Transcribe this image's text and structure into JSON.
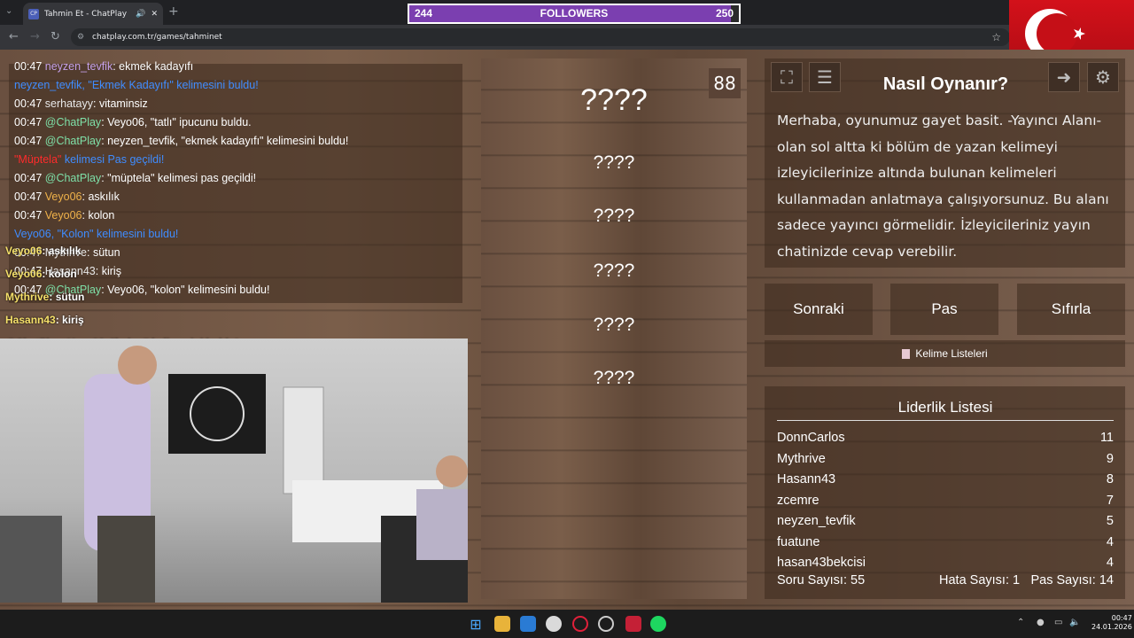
{
  "browser": {
    "tab_title": "Tahmin Et - ChatPlay",
    "tab_favicon": "CP",
    "url": "chatplay.com.tr/games/tahminet"
  },
  "followers": {
    "current": "244",
    "label": "FOLLOWERS",
    "goal": "250",
    "progress": 0.976,
    "color": "#7b3fb0"
  },
  "chat": {
    "lines": [
      {
        "time": "00:47",
        "user": "neyzen_tevfik",
        "sep": ":",
        "text": "ekmek kadayıfı"
      },
      {
        "time": "",
        "user": "neyzen_tevfik, \"Ekmek Kadayıfı\"",
        "sep": "",
        "text": "kelimesini buldu!"
      },
      {
        "time": "00:47",
        "user": "serhatayy",
        "sep": ":",
        "text": "vitaminsiz"
      },
      {
        "time": "00:47",
        "user": "@ChatPlay",
        "sep": ":",
        "text": "Veyo06, \"tatlı\" ipucunu buldu."
      },
      {
        "time": "00:47",
        "user": "@ChatPlay",
        "sep": ":",
        "text": "neyzen_tevfik, \"ekmek kadayıfı\" kelimesini buldu!"
      },
      {
        "time": "",
        "user": "\"Müptela\"",
        "sep": "",
        "text": "kelimesi Pas geçildi!"
      },
      {
        "time": "00:47",
        "user": "@ChatPlay",
        "sep": ":",
        "text": "\"müptela\" kelimesi pas geçildi!"
      },
      {
        "time": "00:47",
        "user": "Veyo06",
        "sep": ":",
        "text": "askılık"
      },
      {
        "time": "00:47",
        "user": "Veyo06",
        "sep": ":",
        "text": "kolon"
      },
      {
        "time": "",
        "user": "Veyo06, \"Kolon\"",
        "sep": "",
        "text": "kelimesini buldu!"
      },
      {
        "time": "00:47",
        "user": "Mythrive",
        "sep": ":",
        "text": "sütun"
      },
      {
        "time": "00:47",
        "user": "Hasann43",
        "sep": ":",
        "text": "kiriş"
      },
      {
        "time": "00:47",
        "user": "@ChatPlay",
        "sep": ":",
        "text": "Veyo06, \"kolon\" kelimesini buldu!"
      }
    ],
    "overlay": [
      {
        "user": "Veyo06",
        "text": ": askılık"
      },
      {
        "user": "Veyo06",
        "text": ": kolon"
      },
      {
        "user": "Mythrive",
        "text": ": sütun"
      },
      {
        "user": "Hasann43",
        "text": ": kiriş"
      },
      {
        "user": "@ChatPlay",
        "text": ": Veyo06, \"kolon\" kelimesini buldu!"
      }
    ]
  },
  "game": {
    "timer": "88",
    "words": [
      "????",
      "????",
      "????",
      "????",
      "????",
      "????"
    ],
    "how_title": "Nasıl Oynanır?",
    "how_text": "Merhaba, oyunumuz gayet basit. -Yayıncı Alanı- olan sol altta ki bölüm de yazan kelimeyi izleyicilerinize altında bulunan kelimeleri kullanmadan anlatmaya çalışıyorsunuz. Bu alanı sadece yayıncı görmelidir. İzleyicileriniz yayın chatinizde cevap verebilir.",
    "buttons": {
      "next": "Sonraki",
      "pass": "Pas",
      "reset": "Sıfırla"
    },
    "word_lists": "Kelime Listeleri",
    "leaderboard": {
      "title": "Liderlik Listesi",
      "rows": [
        {
          "name": "DonnCarlos",
          "score": "11"
        },
        {
          "name": "Mythrive",
          "score": "9"
        },
        {
          "name": "Hasann43",
          "score": "8"
        },
        {
          "name": "zcemre",
          "score": "7"
        },
        {
          "name": "neyzen_tevfik",
          "score": "5"
        },
        {
          "name": "fuatune",
          "score": "4"
        },
        {
          "name": "hasan43bekcisi",
          "score": "4"
        }
      ]
    },
    "stats": {
      "questions": "Soru Sayısı: 55",
      "errors": "Hata Sayısı: 1",
      "passes": "Pas Sayısı: 14"
    }
  },
  "taskbar": {
    "time": "00:47",
    "date": "24.01.2026"
  }
}
